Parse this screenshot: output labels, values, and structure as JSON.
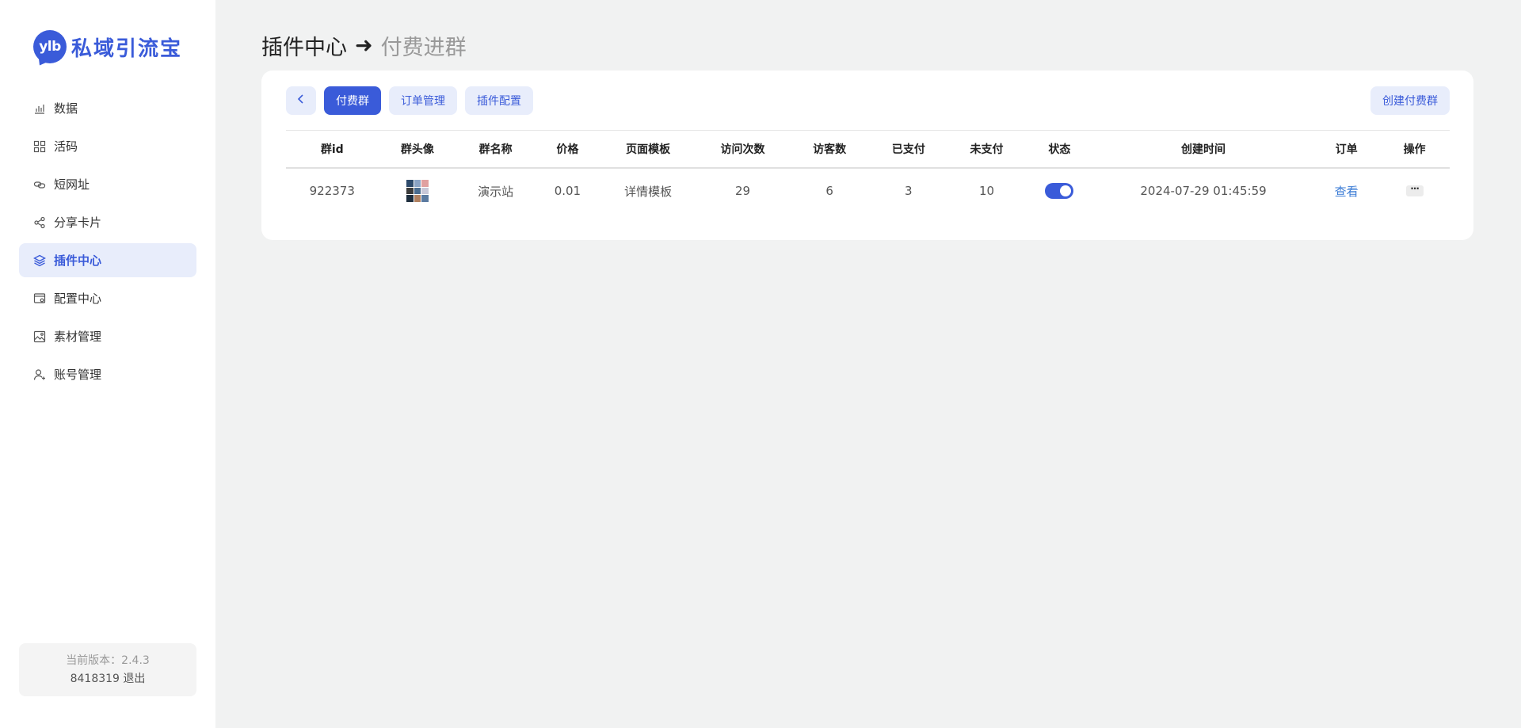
{
  "brand": {
    "badge": "ylb",
    "name": "私域引流宝",
    "color": "#3a5bd9"
  },
  "sidebar": {
    "items": [
      {
        "label": "数据",
        "icon": "bar-chart-icon",
        "active": false
      },
      {
        "label": "活码",
        "icon": "grid-icon",
        "active": false
      },
      {
        "label": "短网址",
        "icon": "link-icon",
        "active": false
      },
      {
        "label": "分享卡片",
        "icon": "share-icon",
        "active": false
      },
      {
        "label": "插件中心",
        "icon": "layers-icon",
        "active": true
      },
      {
        "label": "配置中心",
        "icon": "settings-window-icon",
        "active": false
      },
      {
        "label": "素材管理",
        "icon": "image-icon",
        "active": false
      },
      {
        "label": "账号管理",
        "icon": "user-add-icon",
        "active": false
      }
    ],
    "version_line": "当前版本：2.4.3",
    "account_id": "8418319",
    "logout_label": "退出"
  },
  "header": {
    "title": "插件中心",
    "arrow": "➜",
    "subtitle": "付费进群"
  },
  "toolbar": {
    "tabs": [
      "付费群",
      "订单管理",
      "插件配置"
    ],
    "create_label": "创建付费群"
  },
  "table": {
    "columns": [
      "群id",
      "群头像",
      "群名称",
      "价格",
      "页面模板",
      "访问次数",
      "访客数",
      "已支付",
      "未支付",
      "状态",
      "创建时间",
      "订单",
      "操作"
    ],
    "rows": [
      {
        "id": "922373",
        "name": "演示站",
        "price": "0.01",
        "template": "详情模板",
        "visits": "29",
        "visitors": "6",
        "paid": "3",
        "unpaid": "10",
        "status_on": true,
        "created": "2024-07-29 01:45:59",
        "order_link": "查看",
        "more": "···"
      }
    ]
  },
  "colors": {
    "accent": "#3a5bd9",
    "accent_light": "#e8edfb",
    "link": "#3a7bd5",
    "background": "#f1f2f2"
  }
}
